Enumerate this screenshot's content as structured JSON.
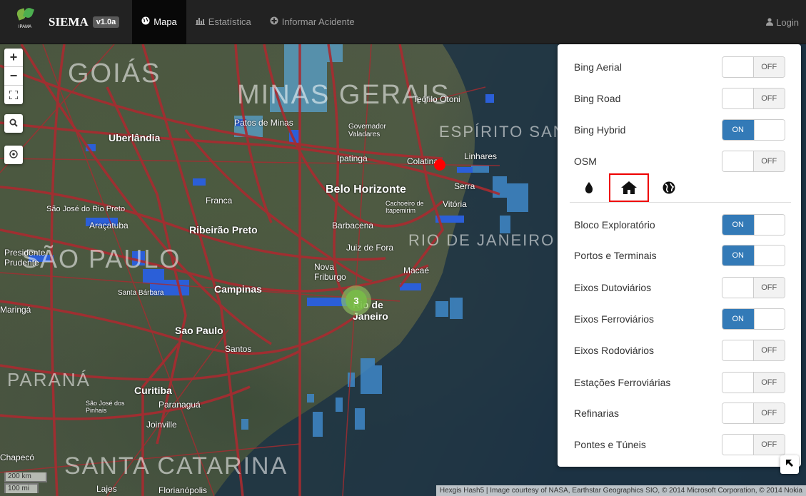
{
  "navbar": {
    "brand": "SIEMA",
    "version": "v1.0a",
    "logo_text": "IPAMA",
    "items": [
      {
        "label": "Mapa",
        "icon": "globe-icon"
      },
      {
        "label": "Estatística",
        "icon": "bar-chart-icon"
      },
      {
        "label": "Informar Acidente",
        "icon": "plus-circle-icon"
      }
    ],
    "login": "Login"
  },
  "map": {
    "controls": {
      "zoom_in": "+",
      "zoom_out": "−"
    },
    "labels": {
      "goias": "GOIÁS",
      "minas": "MINAS GERAIS",
      "espirito": "ESPÍRITO SANTO",
      "rio": "RIO DE JANEIRO",
      "sao_paulo": "SÃO PAULO",
      "parana": "PARANÁ",
      "santa_catarina": "SANTA CATARINA",
      "uberlandia": "Uberlândia",
      "patos": "Patos de Minas",
      "teofilo": "Teófilo Otoni",
      "valadares": "Governador Valadares",
      "ipatinga": "Ipatinga",
      "coutinho": "Colatina",
      "linhares": "Linhares",
      "serra": "Serra",
      "vitoria": "Vitória",
      "bh": "Belo Horizonte",
      "franca": "Franca",
      "ribeirao": "Ribeirão Preto",
      "juiz": "Juiz de Fora",
      "barbacena": "Barbacena",
      "cachoeiro": "Cachoeiro de Itapemirim",
      "rio_preto": "São José do Rio Preto",
      "aracatuba": "Araçatuba",
      "presidente": "Presidente Prudente",
      "campinas": "Campinas",
      "santos": "Santos",
      "sao_paulo_city": "Sao Paulo",
      "rio_city": "Rio de Janeiro",
      "curitiba": "Curitiba",
      "paranagua": "Paranaguá",
      "maringa": "Maringá",
      "joinville": "Joinville",
      "chapeco": "Chapecó",
      "lajes": "Lajes",
      "florianopolis": "Florianópolis",
      "macae": "Macaé",
      "nova_friburgo": "Nova Friburgo",
      "santa_barbara": "Santa Bárbara",
      "sao_jose_pinhais": "São José dos Pinhais"
    },
    "cluster_count": "3",
    "scale": {
      "km": "200 km",
      "mi": "100 mi"
    },
    "attribution": "Hexgis Hash5 | Image courtesy of NASA, Earthstar Geographics SIO, © 2014 Microsoft Corporation, © 2014 Nokia"
  },
  "panel": {
    "base_layers": [
      {
        "label": "Bing Aerial",
        "state": "OFF"
      },
      {
        "label": "Bing Road",
        "state": "OFF"
      },
      {
        "label": "Bing Hybrid",
        "state": "ON"
      },
      {
        "label": "OSM",
        "state": "OFF"
      }
    ],
    "tabs": [
      "water-drop-icon",
      "home-icon",
      "globe-icon"
    ],
    "overlay_layers": [
      {
        "label": "Bloco Exploratório",
        "state": "ON"
      },
      {
        "label": "Portos e Terminais",
        "state": "ON"
      },
      {
        "label": "Eixos Dutoviários",
        "state": "OFF"
      },
      {
        "label": "Eixos Ferroviários",
        "state": "ON"
      },
      {
        "label": "Eixos Rodoviários",
        "state": "OFF"
      },
      {
        "label": "Estações Ferroviárias",
        "state": "OFF"
      },
      {
        "label": "Refinarias",
        "state": "OFF"
      },
      {
        "label": "Pontes e Túneis",
        "state": "OFF"
      }
    ]
  }
}
